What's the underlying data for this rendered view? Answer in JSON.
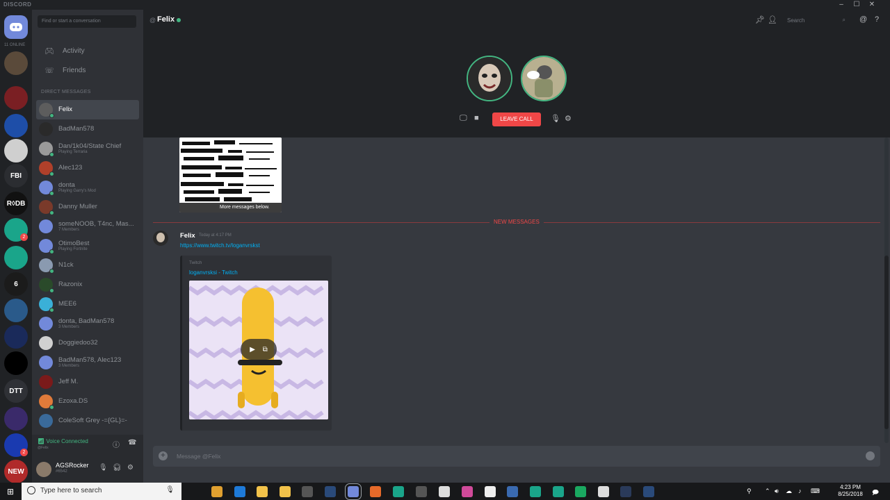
{
  "app": {
    "brand": "DISCORD",
    "online_label": "11 ONLINE"
  },
  "window_controls": {
    "minimize": "–",
    "maximize": "☐",
    "close": "✕"
  },
  "servers": [
    {
      "name": "user-server-1",
      "color": "#5a4a3a",
      "badge": null
    },
    {
      "name": "red-server",
      "color": "#7a1f23",
      "badge": null
    },
    {
      "name": "ems-server",
      "color": "#1e4ea8",
      "badge": null
    },
    {
      "name": "state-chief-server",
      "color": "#cfcfcf",
      "badge": null
    },
    {
      "name": "fbi-server",
      "color": "#2b2d31",
      "label": "FBI",
      "badge": null
    },
    {
      "name": "rdb-server",
      "color": "#111111",
      "label": "R◊DB",
      "badge": null
    },
    {
      "name": "robot-server-1",
      "color": "#1aa58a",
      "badge": "2"
    },
    {
      "name": "robot-server-2",
      "color": "#1aa58a",
      "badge": null
    },
    {
      "name": "r6-server",
      "color": "#1b1b1b",
      "label": "6",
      "badge": null
    },
    {
      "name": "globe-server",
      "color": "#2a5a8a",
      "badge": null
    },
    {
      "name": "planet-server",
      "color": "#1a2a5a",
      "badge": null
    },
    {
      "name": "emblem-server",
      "color": "#000000",
      "badge": null
    },
    {
      "name": "dtt-server",
      "color": "#2f3136",
      "label": "DTT",
      "badge": null
    },
    {
      "name": "crystal-server",
      "color": "#3a2a6a",
      "badge": null
    },
    {
      "name": "blue-server",
      "color": "#1a3ab0",
      "badge": "2"
    },
    {
      "name": "new-server",
      "color": "#b02a2a",
      "label": "NEW",
      "badge": null
    }
  ],
  "sidebar": {
    "search_placeholder": "Find or start a conversation",
    "nav": [
      {
        "label": "Activity",
        "icon": "gamepad-icon"
      },
      {
        "label": "Friends",
        "icon": "friends-icon"
      }
    ],
    "dm_header": "DIRECT MESSAGES",
    "dms": [
      {
        "name": "Felix",
        "sub": "",
        "color": "#5d5d5d",
        "status": true,
        "active": true
      },
      {
        "name": "BadMan578",
        "sub": "",
        "color": "#2a2a2a",
        "status": false,
        "active": false
      },
      {
        "name": "Dan/1k04/State Chief",
        "sub": "Playing Terraria",
        "color": "#9a9a9a",
        "status": true,
        "active": false
      },
      {
        "name": "Alec123",
        "sub": "",
        "color": "#b0402a",
        "status": true,
        "active": false
      },
      {
        "name": "donta",
        "sub": "Playing Garry's Mod",
        "color": "#7289da",
        "status": true,
        "active": false
      },
      {
        "name": "Danny Muller",
        "sub": "",
        "color": "#7a3a2a",
        "status": true,
        "active": false
      },
      {
        "name": "someNOOB, T4nc, Mas...",
        "sub": "7 Members",
        "color": "#7289da",
        "status": false,
        "active": false
      },
      {
        "name": "OtimoBest",
        "sub": "Playing Fortnite",
        "color": "#7289da",
        "status": true,
        "active": false
      },
      {
        "name": "N1ck",
        "sub": "",
        "color": "#8a9ab0",
        "status": true,
        "active": false
      },
      {
        "name": "Razonix",
        "sub": "",
        "color": "#2a4a2a",
        "status": true,
        "active": false
      },
      {
        "name": "MEE6",
        "sub": "",
        "color": "#3ab0d8",
        "status": true,
        "active": false
      },
      {
        "name": "donta, BadMan578",
        "sub": "3 Members",
        "color": "#7289da",
        "status": false,
        "active": false
      },
      {
        "name": "Doggiedoo32",
        "sub": "",
        "color": "#d0d0d0",
        "status": false,
        "active": false
      },
      {
        "name": "BadMan578, Alec123",
        "sub": "3 Members",
        "color": "#7289da",
        "status": false,
        "active": false
      },
      {
        "name": "Jeff M.",
        "sub": "",
        "color": "#7a1a1a",
        "status": false,
        "active": false
      },
      {
        "name": "Ezoxa.DS",
        "sub": "",
        "color": "#e07a3a",
        "status": true,
        "active": false
      },
      {
        "name": "ColeSoft Grey -={GL}=-",
        "sub": "",
        "color": "#3a6a9a",
        "status": false,
        "active": false
      }
    ]
  },
  "voice": {
    "status": "Voice Connected",
    "channel": "@Felix"
  },
  "user": {
    "name": "AGSRocker",
    "tag": "#6542"
  },
  "header": {
    "at_symbol": "@",
    "title": "Felix",
    "search_placeholder": "Search"
  },
  "call": {
    "leave_label": "LEAVE CALL"
  },
  "chat": {
    "more_messages": "More messages below.",
    "new_messages": "NEW MESSAGES",
    "message": {
      "author": "Felix",
      "time": "Today at 4:17 PM",
      "link": "https://www.twitch.tv/loganvrskst"
    },
    "embed": {
      "provider": "Twitch",
      "title": "loganvrsksi - Twitch"
    }
  },
  "composer": {
    "placeholder": "Message @Felix"
  },
  "taskbar": {
    "search_placeholder": "Type here to search",
    "time": "4:23 PM",
    "date": "8/25/2018"
  },
  "colors": {
    "accent": "#7289da",
    "online": "#43b581",
    "danger": "#f04747",
    "link": "#00b0f4"
  }
}
